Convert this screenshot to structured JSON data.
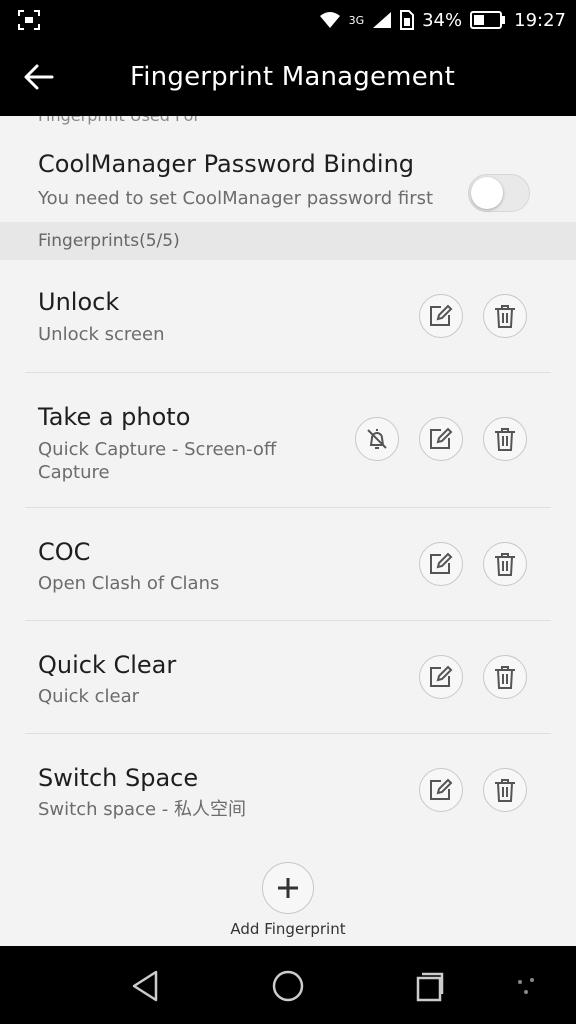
{
  "status": {
    "battery_pct": "34%",
    "time": "19:27",
    "network": "3G"
  },
  "header": {
    "title": "Fingerprint Management"
  },
  "section_used_for": "Fingerprint Used For",
  "binding": {
    "title": "CoolManager Password Binding",
    "subtitle": "You need to set CoolManager password first",
    "enabled": false
  },
  "fingerprints_header": "Fingerprints(5/5)",
  "fingerprints": [
    {
      "title": "Unlock",
      "subtitle": "Unlock screen"
    },
    {
      "title": "Take a photo",
      "subtitle": "Quick Capture - Screen-off Capture"
    },
    {
      "title": "COC",
      "subtitle": "Open Clash of Clans"
    },
    {
      "title": "Quick Clear",
      "subtitle": "Quick clear"
    },
    {
      "title": "Switch Space",
      "subtitle": "Switch space - 私人空间"
    }
  ],
  "add": {
    "label": "Add Fingerprint"
  },
  "icons": {
    "edit": "edit-icon",
    "delete": "trash-icon",
    "bell": "bell-off-icon",
    "add": "plus-icon"
  }
}
